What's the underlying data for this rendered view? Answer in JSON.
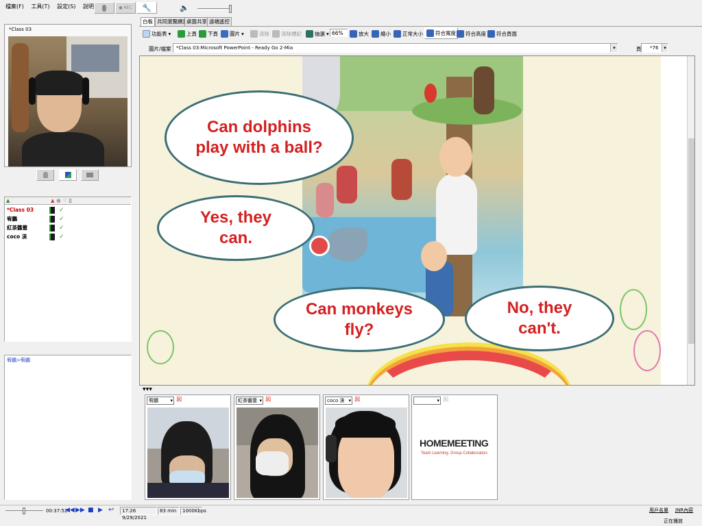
{
  "menu": [
    "檔案(F)",
    "工具(T)",
    "設定(S)",
    "說明(H)"
  ],
  "top_toolbar": {
    "rec_label": "● REC"
  },
  "left_panel": {
    "class_label": "*Class 03",
    "users_list": [
      {
        "name": "*Class 03",
        "color": "#c00000"
      },
      {
        "name": "宥鵬",
        "color": "#000000"
      },
      {
        "name": "紅茶醬蕓",
        "color": "#000000"
      },
      {
        "name": "coco 渼",
        "color": "#000000"
      }
    ],
    "chat_line": "宥鵬>宥鵬"
  },
  "tabs": [
    "白板",
    "共同瀏覽網頁",
    "桌面共享",
    "遠端遙控"
  ],
  "toolbar": {
    "function_table": "功能表",
    "prev_page": "上頁",
    "next_page": "下頁",
    "picture": "圖片",
    "clear": "清除",
    "clear_marks": "清除標記",
    "select": "抽選",
    "zoom_value": "66%",
    "zoom_in": "放大",
    "zoom_out": "縮小",
    "normal_size": "正常大小",
    "fit_width": "符合寬度",
    "fit_height": "符合高度",
    "fit_page": "符合頁面"
  },
  "file_bar": {
    "label": "圖片/檔案",
    "value": "*Class 03:Microsoft PowerPoint - Ready Go 2-Mia",
    "page_label": "頁",
    "page_value": "*76"
  },
  "slide": {
    "bubble1": "Can dolphins play with a ball?",
    "bubble2": "Yes, they can.",
    "bubble3": "Can monkeys fly?",
    "bubble4": "No, they can't."
  },
  "video_panels": [
    {
      "name": "宥鵬"
    },
    {
      "name": "紅茶醬蕓"
    },
    {
      "name": "coco 渼"
    },
    {
      "name": ""
    }
  ],
  "logo": {
    "brand": "HOMEMEETING",
    "tagline": "Team Learning. Group Collaboration."
  },
  "status": {
    "time_elapsed": "00:37:52",
    "timestamp": "17:26 9/29/2021",
    "duration": "83 min",
    "bitrate": "1000Kbps",
    "user_list_btn": "用戶名單",
    "jnr_btn": "JNR內容",
    "playing": "正在播放"
  },
  "colors": {
    "bubble_text": "#d32020",
    "bubble_border": "#3b6e74",
    "slide_bg": "#f7f2dc"
  }
}
